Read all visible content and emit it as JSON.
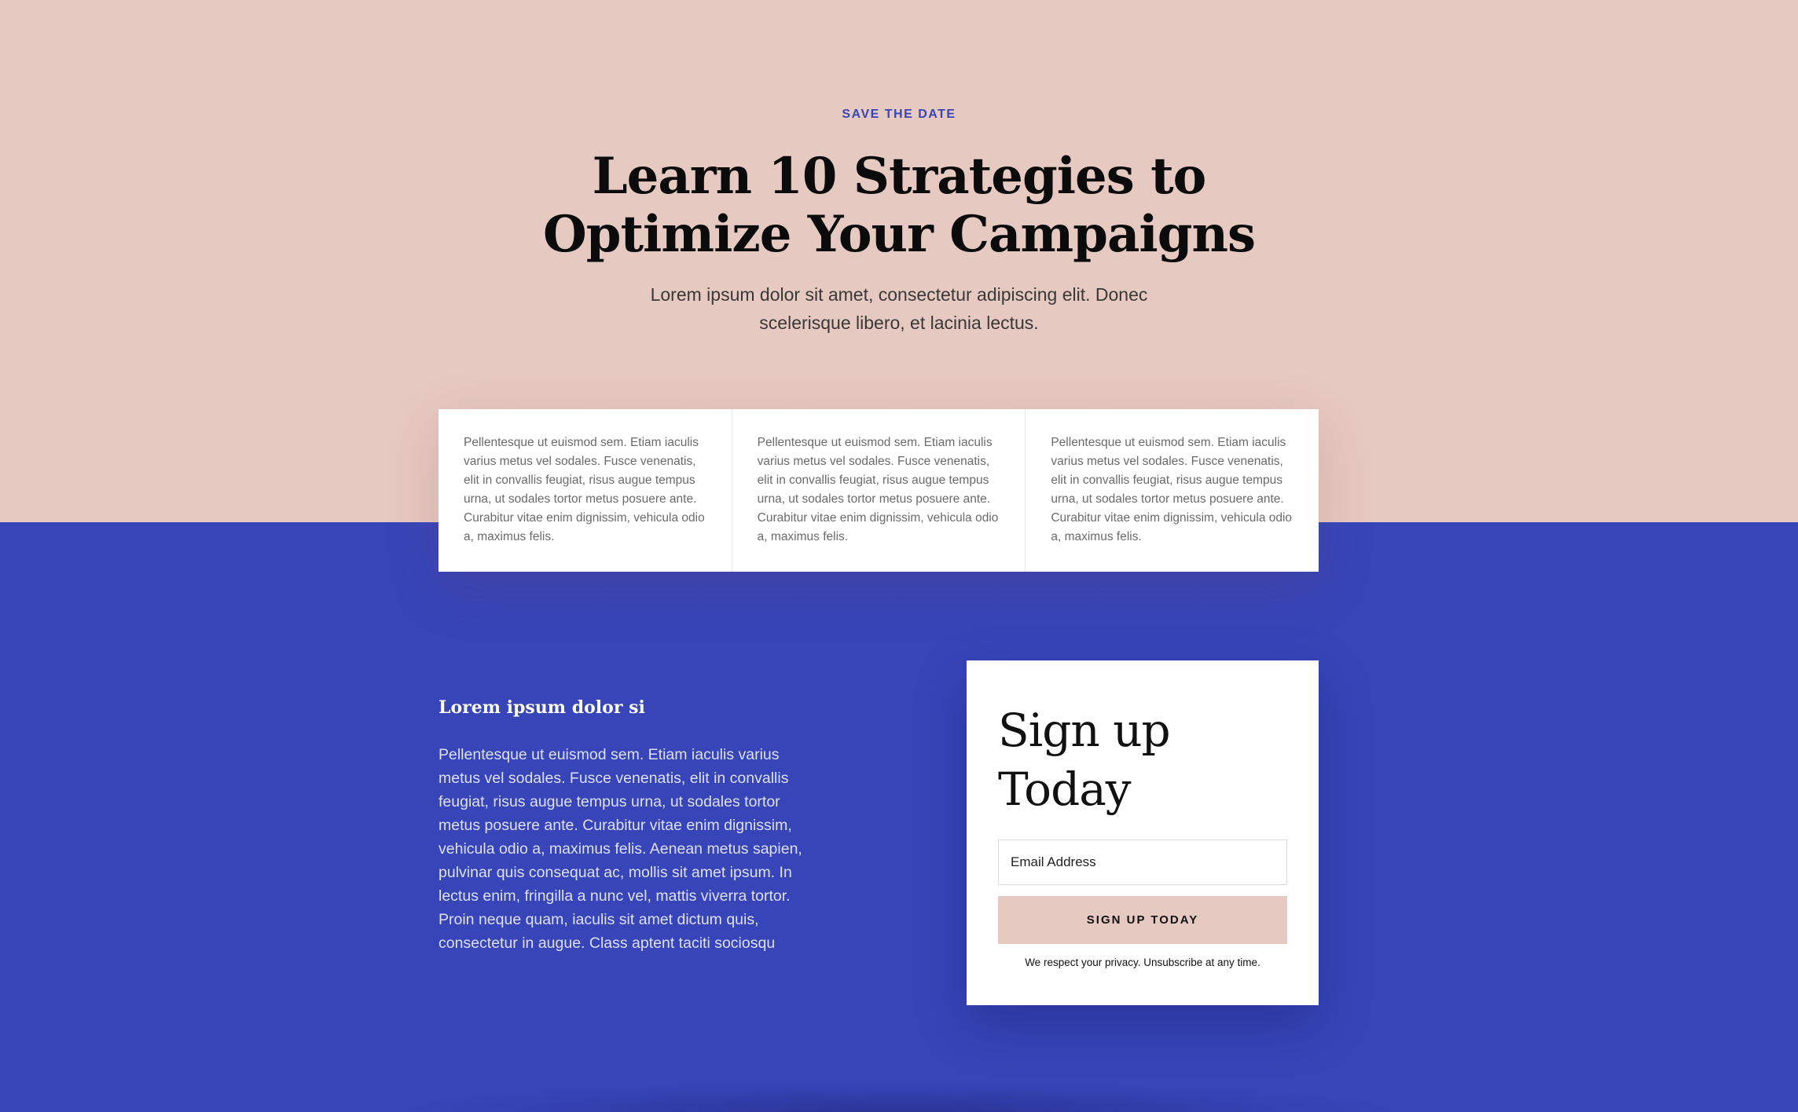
{
  "hero": {
    "eyebrow": "SAVE THE DATE",
    "title_line1": "Learn 10 Strategies to",
    "title_line2": "Optimize Your Campaigns",
    "subtitle": "Lorem ipsum dolor sit amet, consectetur adipiscing elit. Donec scelerisque libero, et lacinia lectus."
  },
  "cards": [
    {
      "text": "Pellentesque ut euismod sem. Etiam iaculis varius metus vel sodales. Fusce venenatis, elit in convallis feugiat, risus augue tempus urna, ut sodales tortor metus posuere ante. Curabitur vitae enim dignissim, vehicula odio a, maximus felis."
    },
    {
      "text": "Pellentesque ut euismod sem. Etiam iaculis varius metus vel sodales. Fusce venenatis, elit in convallis feugiat, risus augue tempus urna, ut sodales tortor metus posuere ante. Curabitur vitae enim dignissim, vehicula odio a, maximus felis."
    },
    {
      "text": "Pellentesque ut euismod sem. Etiam iaculis varius metus vel sodales. Fusce venenatis, elit in convallis feugiat, risus augue tempus urna, ut sodales tortor metus posuere ante. Curabitur vitae enim dignissim, vehicula odio a, maximus felis."
    }
  ],
  "feature": {
    "title": "Lorem ipsum dolor si",
    "body": "Pellentesque ut euismod sem. Etiam iaculis varius metus vel sodales. Fusce venenatis, elit in convallis feugiat, risus augue tempus urna, ut sodales tortor metus posuere ante. Curabitur vitae enim dignissim, vehicula odio a, maximus felis. Aenean metus sapien, pulvinar quis consequat ac, mollis sit amet ipsum. In lectus enim, fringilla a nunc vel, mattis viverra tortor. Proin neque quam, iaculis sit amet dictum quis, consectetur in augue. Class aptent taciti sociosqu"
  },
  "signup": {
    "title_line1": "Sign up",
    "title_line2": "Today",
    "email_placeholder": "Email Address",
    "email_value": "",
    "button_label": "SIGN UP TODAY",
    "privacy_note": "We respect your privacy. Unsubscribe at any time."
  },
  "colors": {
    "hero_background": "#e6c9c1",
    "band_background": "#3745b9",
    "accent_text": "#3745b9",
    "button_background": "#e6c9c1"
  }
}
